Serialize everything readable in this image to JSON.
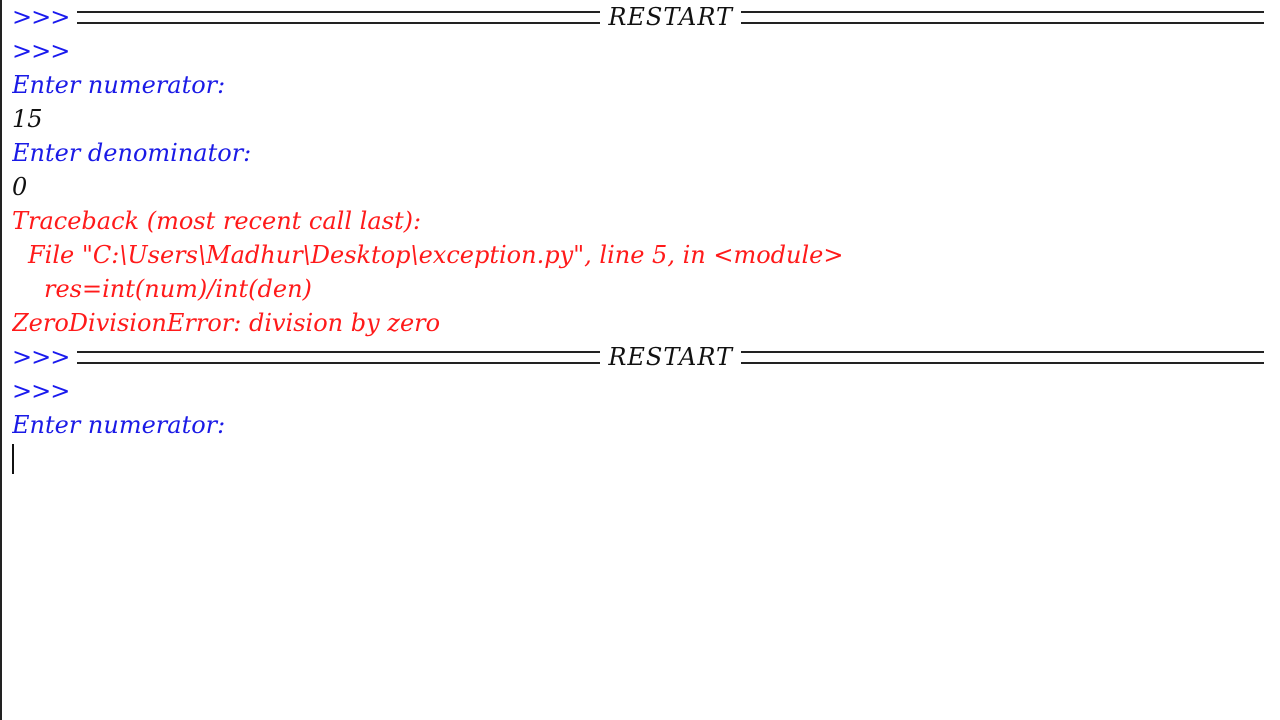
{
  "shell": {
    "lines": [
      {
        "type": "restart",
        "prompt": ">>>",
        "label": "RESTART"
      },
      {
        "type": "prompt",
        "text": ">>>"
      },
      {
        "type": "stdout",
        "text": "Enter numerator:"
      },
      {
        "type": "stdin",
        "text": "15"
      },
      {
        "type": "stdout",
        "text": "Enter denominator:"
      },
      {
        "type": "stdin",
        "text": "0"
      },
      {
        "type": "stderr",
        "text": "Traceback (most recent call last):"
      },
      {
        "type": "stderr",
        "text": "File \"C:\\Users\\Madhur\\Desktop\\exception.py\", line 5, in <module>"
      },
      {
        "type": "stderr",
        "text": "res=int(num)/int(den)"
      },
      {
        "type": "stderr",
        "text": "ZeroDivisionError: division by zero"
      },
      {
        "type": "restart",
        "prompt": ">>>",
        "label": "RESTART"
      },
      {
        "type": "prompt",
        "text": ">>>"
      },
      {
        "type": "stdout",
        "text": "Enter numerator:"
      }
    ],
    "input_value": ""
  },
  "colors": {
    "stdout": "#1a1ae6",
    "stdin": "#111111",
    "stderr": "#ff1a1a",
    "prompt": "#1a1aee",
    "background": "#ffffff"
  }
}
